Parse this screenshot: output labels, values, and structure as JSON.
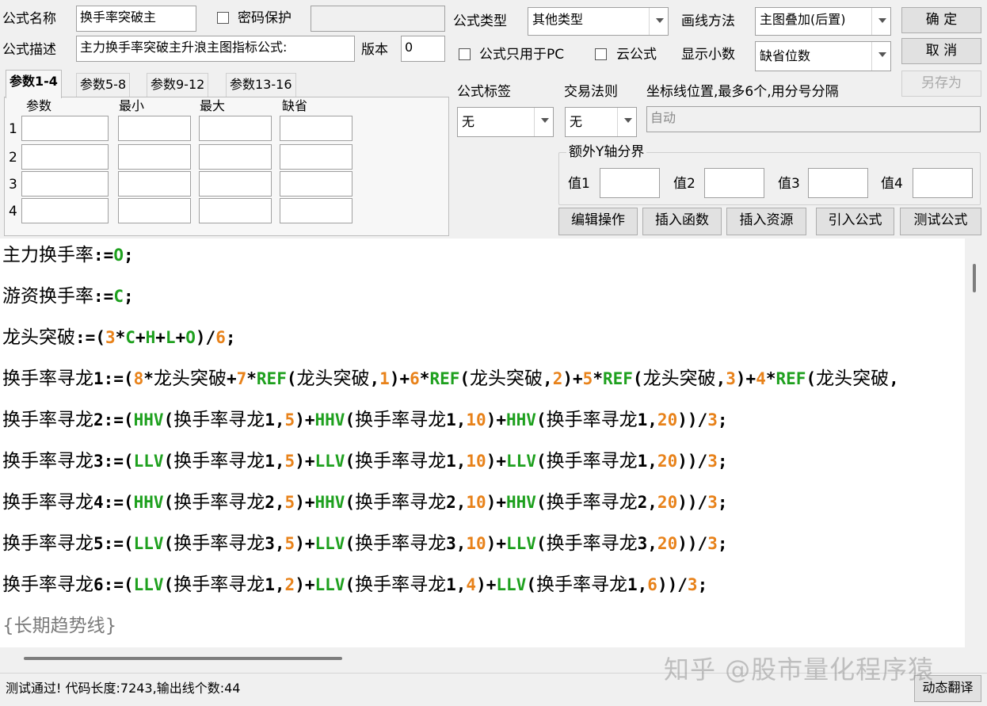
{
  "header": {
    "name_label": "公式名称",
    "name_value": "换手率突破主",
    "password_label": "密码保护",
    "desc_label": "公式描述",
    "desc_value": "主力换手率突破主升浪主图指标公式:",
    "version_label": "版本",
    "version_value": "0",
    "type_label": "公式类型",
    "type_value": "其他类型",
    "draw_label": "画线方法",
    "draw_value": "主图叠加(后置)",
    "pc_only_label": "公式只用于PC",
    "cloud_label": "云公式",
    "decimal_label": "显示小数",
    "decimal_value": "缺省位数",
    "ok_label": "确  定",
    "cancel_label": "取  消",
    "saveas_label": "另存为"
  },
  "params": {
    "tabs": [
      "参数1-4",
      "参数5-8",
      "参数9-12",
      "参数13-16"
    ],
    "columns": [
      "参数",
      "最小",
      "最大",
      "缺省"
    ],
    "rows": [
      "1",
      "2",
      "3",
      "4"
    ]
  },
  "right_panel": {
    "tag_label": "公式标签",
    "tag_value": "无",
    "rule_label": "交易法则",
    "rule_value": "无",
    "coord_label": "坐标线位置,最多6个,用分号分隔",
    "coord_value": "自动",
    "yaxis_group_label": "额外Y轴分界",
    "v1_label": "值1",
    "v2_label": "值2",
    "v3_label": "值3",
    "v4_label": "值4"
  },
  "actions": [
    "编辑操作",
    "插入函数",
    "插入资源",
    "引入公式",
    "测试公式"
  ],
  "code_lines": [
    "主力换手率:=O;",
    "游资换手率:=C;",
    "龙头突破:=(3*C+H+L+O)/6;",
    "换手率寻龙1:=(8*龙头突破+7*REF(龙头突破,1)+6*REF(龙头突破,2)+5*REF(龙头突破,3)+4*REF(龙头突破,",
    "换手率寻龙2:=(HHV(换手率寻龙1,5)+HHV(换手率寻龙1,10)+HHV(换手率寻龙1,20))/3;",
    "换手率寻龙3:=(LLV(换手率寻龙1,5)+LLV(换手率寻龙1,10)+LLV(换手率寻龙1,20))/3;",
    "换手率寻龙4:=(HHV(换手率寻龙2,5)+HHV(换手率寻龙2,10)+HHV(换手率寻龙2,20))/3;",
    "换手率寻龙5:=(LLV(换手率寻龙3,5)+LLV(换手率寻龙3,10)+LLV(换手率寻龙3,20))/3;",
    "换手率寻龙6:=(LLV(换手率寻龙1,2)+LLV(换手率寻龙1,4)+LLV(换手率寻龙1,6))/3;",
    "{长期趋势线}"
  ],
  "status": {
    "message": "测试通过! 代码长度:7243,输出线个数:44",
    "translate_label": "动态翻译"
  },
  "watermark": "知乎 @股市量化程序猿",
  "colors": {
    "function": "#1ea01e",
    "number": "#e8821a",
    "comment": "#7a7a7a"
  }
}
